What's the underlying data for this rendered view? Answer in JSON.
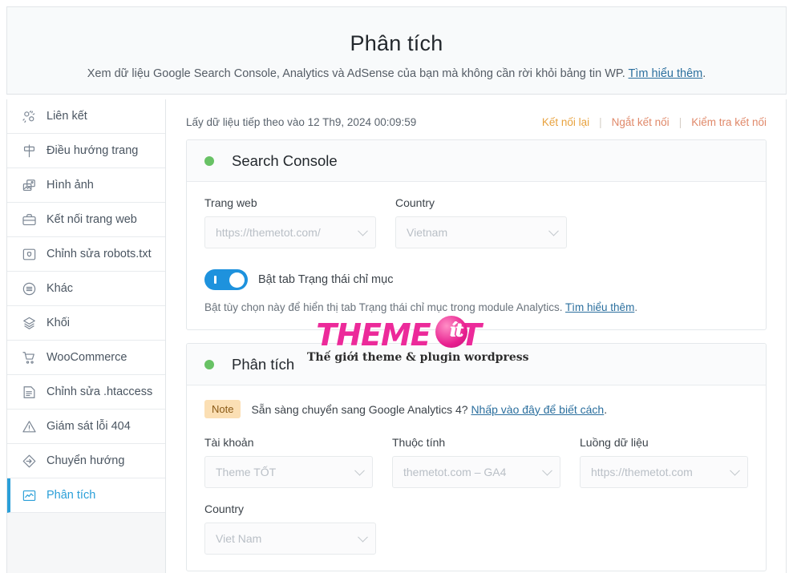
{
  "header": {
    "title": "Phân tích",
    "subtitle_before": "Xem dữ liệu Google Search Console, Analytics và AdSense của bạn mà không cần rời khỏi bảng tin WP.",
    "subtitle_link": "Tìm hiểu thêm",
    "subtitle_after": "."
  },
  "sidebar": {
    "items": [
      {
        "label": "Liên kết",
        "icon": "link-icon",
        "active": false
      },
      {
        "label": "Điều hướng trang",
        "icon": "signpost-icon",
        "active": false
      },
      {
        "label": "Hình ảnh",
        "icon": "images-icon",
        "active": false
      },
      {
        "label": "Kết nối trang web",
        "icon": "briefcase-icon",
        "active": false
      },
      {
        "label": "Chỉnh sửa robots.txt",
        "icon": "folder-shield-icon",
        "active": false
      },
      {
        "label": "Khác",
        "icon": "menu-circle-icon",
        "active": false
      },
      {
        "label": "Khối",
        "icon": "layers-icon",
        "active": false
      },
      {
        "label": "WooCommerce",
        "icon": "cart-icon",
        "active": false
      },
      {
        "label": "Chỉnh sửa .htaccess",
        "icon": "document-icon",
        "active": false
      },
      {
        "label": "Giám sát lỗi 404",
        "icon": "warning-triangle-icon",
        "active": false
      },
      {
        "label": "Chuyển hướng",
        "icon": "redirect-diamond-icon",
        "active": false
      },
      {
        "label": "Phân tích",
        "icon": "analytics-chart-icon",
        "active": true
      }
    ]
  },
  "status": {
    "text": "Lấy dữ liệu tiếp theo vào 12 Th9, 2024 00:09:59",
    "links": [
      {
        "label": "Kết nối lại"
      },
      {
        "label": "Ngắt kết nối"
      },
      {
        "label": "Kiểm tra kết nối"
      }
    ],
    "separator": "|"
  },
  "search_console": {
    "title": "Search Console",
    "status_color": "#68c265",
    "site_label": "Trang web",
    "site_value": "https://themetot.com/",
    "country_label": "Country",
    "country_value": "Vietnam",
    "toggle_label": "Bật tab Trạng thái chỉ mục",
    "toggle_on": true,
    "help_before": "Bật tùy chọn này để hiển thị tab Trạng thái chỉ mục trong module Analytics.",
    "help_link": "Tìm hiểu thêm",
    "help_after": "."
  },
  "analytics": {
    "title": "Phân tích",
    "status_color": "#68c265",
    "note_badge": "Note",
    "note_before": "Sẵn sàng chuyển sang Google Analytics 4?",
    "note_link": "Nhấp vào đây để biết cách",
    "note_after": ".",
    "account_label": "Tài khoản",
    "account_value": "Theme TỐT",
    "property_label": "Thuộc tính",
    "property_value": "themetot.com – GA4",
    "stream_label": "Luồng dữ liệu",
    "stream_value": "https://themetot.com",
    "country_label": "Country",
    "country_value": "Viet Nam"
  },
  "watermark": {
    "main_a": "THEME T",
    "main_b": "T",
    "blob_letter": "ít",
    "sub": "Thế giới theme & plugin wordpress"
  }
}
